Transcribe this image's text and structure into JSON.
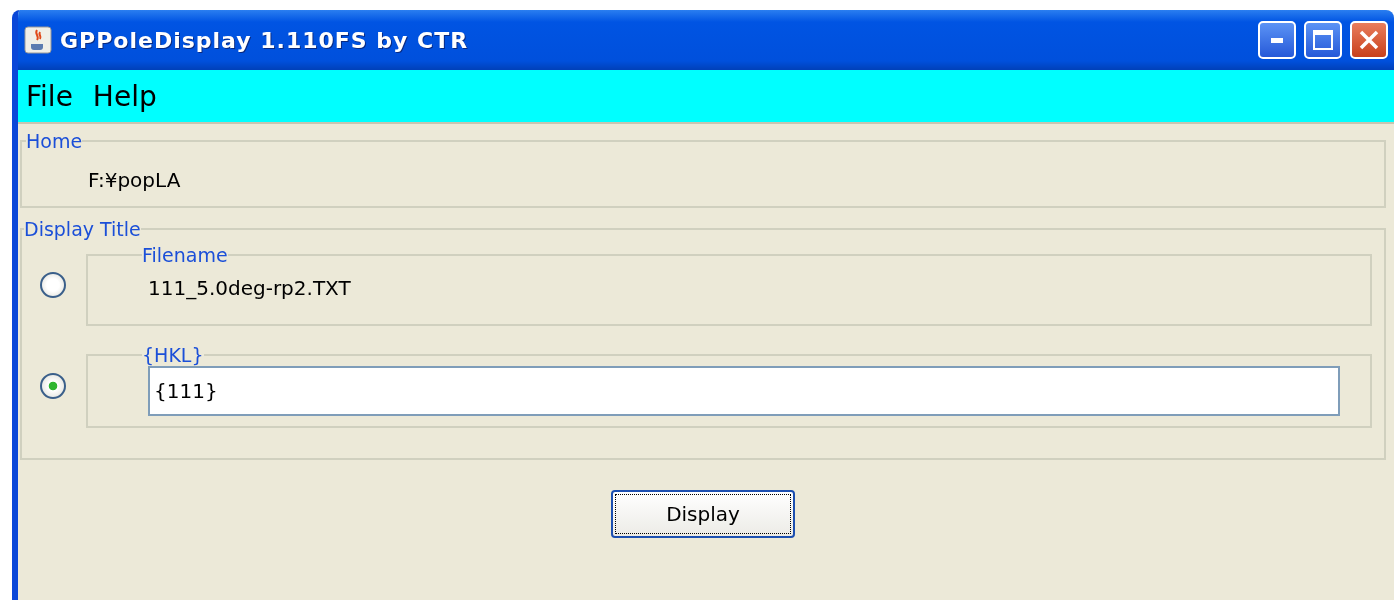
{
  "window": {
    "title": "GPPoleDisplay 1.110FS by CTR"
  },
  "menu": [
    "File",
    "Help"
  ],
  "home": {
    "legend": "Home",
    "path": "F:¥popLA"
  },
  "display_title": {
    "legend": "Display Title",
    "options": [
      {
        "kind": "text",
        "legend": "Filename",
        "value": "111_5.0deg-rp2.TXT",
        "selected": false
      },
      {
        "kind": "input",
        "legend": "{HKL}",
        "value": "{111}",
        "selected": true
      }
    ]
  },
  "button": "Display"
}
